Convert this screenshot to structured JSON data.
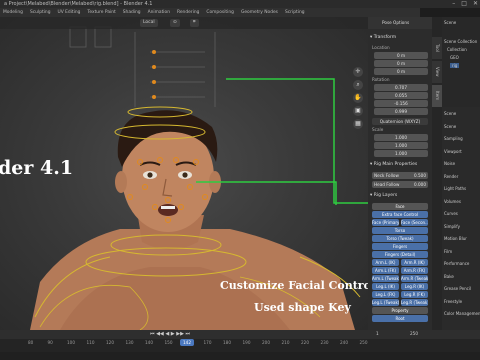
{
  "window": {
    "title": "a Project\\Melabed\\Blender\\Melabed\\rig.blend] - Blender 4.1"
  },
  "menubar": {
    "items": [
      "Modeling",
      "Sculpting",
      "UV Editing",
      "Texture Paint",
      "Shading",
      "Animation",
      "Rendering",
      "Compositing",
      "Geometry Nodes",
      "Scripting"
    ]
  },
  "viewport": {
    "mode_label": "Local",
    "overlay_title": "der 4.1",
    "caption_line1": "Customize Facial Control",
    "caption_line2": "Used shape Key"
  },
  "npanel": {
    "header": "Pose Options",
    "transform": {
      "title": "Transform",
      "location_label": "Location",
      "location": [
        "0 m",
        "0 m",
        "0 m"
      ],
      "rotation_label": "Rotation",
      "rotation": [
        "0.707",
        "0.055",
        "-0.156",
        "0.999"
      ],
      "mode": "Quaternion (WXYZ)",
      "scale_label": "Scale",
      "scale": [
        "1.000",
        "1.000",
        "1.000"
      ]
    },
    "rig_main": {
      "title": "Rig Main Properties",
      "neck_follow_label": "Neck Follow",
      "neck_follow": "0.500",
      "head_follow_label": "Head Follow",
      "head_follow": "0.000"
    },
    "rig_layers": {
      "title": "Rig Layers",
      "buttons": [
        [
          "Face"
        ],
        [
          "Extra face Control"
        ],
        [
          "Face (Primary)",
          "Face (Secon..."
        ],
        [
          "Torso"
        ],
        [
          "Torso (Tweak)"
        ],
        [
          "Fingers"
        ],
        [
          "Fingers (Detail)"
        ],
        [
          "Arm.L (IK)",
          "Arm.R (IK)"
        ],
        [
          "Arm.L (FK)",
          "Arm.R (FK)"
        ],
        [
          "Arm.L (Tweak)",
          "Arm.R (Tweak)"
        ],
        [
          "Leg.L (IK)",
          "Leg.R (IK)"
        ],
        [
          "Leg.L (FK)",
          "Leg.R (FK)"
        ],
        [
          "Leg.L (Tweak)",
          "Leg.R (Tweak)"
        ],
        [
          "Property"
        ],
        [
          "Root"
        ]
      ]
    }
  },
  "vtabs": [
    "Tool",
    "View",
    "Item"
  ],
  "outliner": {
    "rows": [
      "Scene",
      "Scene Collection",
      "Collection",
      "GEO",
      "rig"
    ]
  },
  "properties": {
    "rows": [
      "Scene",
      "Scene",
      "Sampling",
      "Viewport",
      "Noise",
      "Render",
      "Light Paths",
      "Volumes",
      "Curves",
      "Simplify",
      "Motion Blur",
      "Film",
      "Performance",
      "Bake",
      "Grease Pencil",
      "Freestyle",
      "Color Management"
    ]
  },
  "timeline": {
    "ticks": [
      "80",
      "90",
      "100",
      "110",
      "120",
      "130",
      "140",
      "150",
      "160",
      "170",
      "180",
      "190",
      "200",
      "210",
      "220",
      "230",
      "240",
      "250"
    ],
    "current_frame": "142",
    "start": "1",
    "end": "250"
  },
  "colors": {
    "accent": "#4a78c0",
    "green_line": "#2ecc40",
    "bone_yellow": "#d6b830",
    "bone_orange": "#e08a1e"
  }
}
